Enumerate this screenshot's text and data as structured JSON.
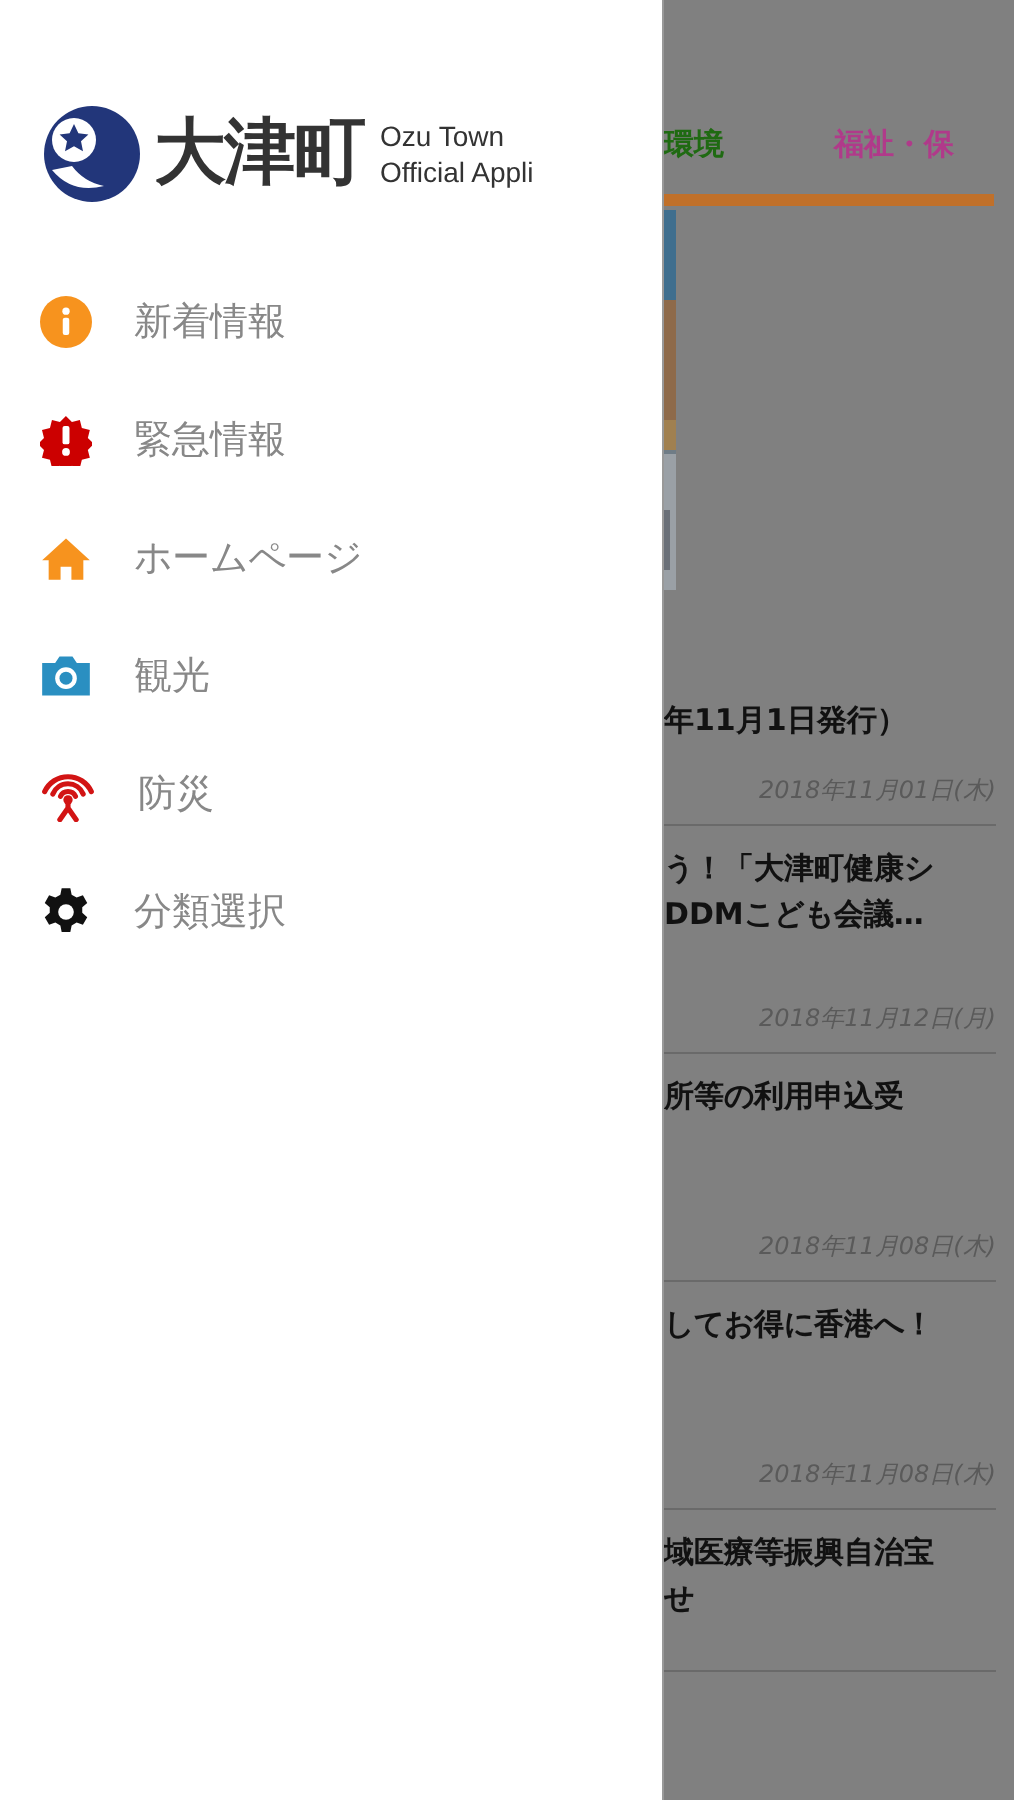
{
  "drawer": {
    "logo": {
      "name": "大津町",
      "subtitle_1": "Ozu Town",
      "subtitle_2": "Official Appli"
    },
    "items": [
      {
        "kind": "info",
        "label": "新着情報"
      },
      {
        "kind": "alert",
        "label": "緊急情報"
      },
      {
        "kind": "home",
        "label": "ホームページ"
      },
      {
        "kind": "camera",
        "label": "観光"
      },
      {
        "kind": "antenna",
        "label": "防災"
      },
      {
        "kind": "gear",
        "label": "分類選択"
      }
    ]
  },
  "background_page": {
    "tabs": [
      {
        "label": "環境",
        "color": "#1f6a12"
      },
      {
        "label": "福祉・保",
        "color": "#b03a8a"
      }
    ],
    "news": [
      {
        "title_lines": [
          "年11月1日発行）"
        ],
        "date": "2018年11月01日(木)"
      },
      {
        "title_lines": [
          "う！「大津町健康シ",
          "DDMこども会議…"
        ],
        "date": "2018年11月12日(月)"
      },
      {
        "title_lines": [
          "所等の利用申込受"
        ],
        "date": "2018年11月08日(木)"
      },
      {
        "title_lines": [
          "してお得に香港へ！"
        ],
        "date": "2018年11月08日(木)"
      },
      {
        "title_lines": [
          "域医療等振興自治宝",
          "せ"
        ]
      }
    ]
  }
}
